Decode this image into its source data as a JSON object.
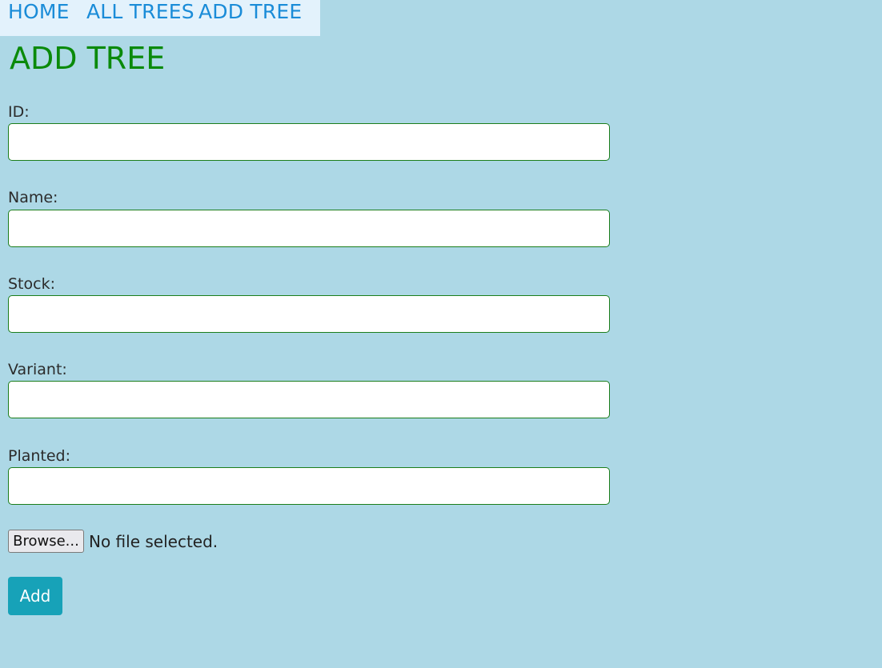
{
  "nav": {
    "items": [
      {
        "label": "HOME"
      },
      {
        "label": "ALL TREES"
      },
      {
        "label": "ADD TREE"
      }
    ]
  },
  "page": {
    "title": "ADD TREE"
  },
  "form": {
    "fields": [
      {
        "label": "ID:",
        "value": "",
        "placeholder": ""
      },
      {
        "label": "Name:",
        "value": "",
        "placeholder": ""
      },
      {
        "label": "Stock:",
        "value": "",
        "placeholder": ""
      },
      {
        "label": "Variant:",
        "value": "",
        "placeholder": ""
      },
      {
        "label": "Planted:",
        "value": "",
        "placeholder": ""
      }
    ],
    "file": {
      "button_label": "Browse...",
      "status": "No file selected."
    },
    "submit_label": "Add"
  },
  "colors": {
    "background": "#add8e6",
    "nav_background": "#e3f2fc",
    "nav_link": "#1a8cd8",
    "title": "#0a8a0a",
    "input_border": "#1b7d1b",
    "submit_button": "#17a2b8"
  }
}
